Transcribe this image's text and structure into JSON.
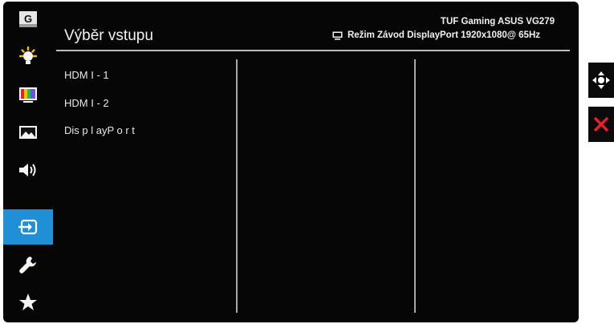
{
  "header": {
    "title": "Výběr vstupu",
    "model": "TUF Gaming ASUS VG279",
    "status": "Režim Závod DisplayPort 1920x1080@ 65Hz"
  },
  "sidebar": {
    "items": [
      {
        "icon": "gamevisual-icon",
        "label": "G"
      },
      {
        "icon": "blue-light-filter-icon"
      },
      {
        "icon": "color-icon"
      },
      {
        "icon": "image-icon"
      },
      {
        "icon": "sound-icon"
      },
      {
        "icon": "input-select-icon",
        "selected": true
      },
      {
        "icon": "system-setup-icon"
      },
      {
        "icon": "my-favorite-icon"
      }
    ]
  },
  "menu": {
    "items": [
      "HDM I - 1",
      "HDM I - 2",
      "Dis p l ayP o r t"
    ]
  },
  "right_buttons": [
    {
      "icon": "navigate-icon"
    },
    {
      "icon": "close-icon"
    }
  ],
  "colors": {
    "background": "#060606",
    "selected": "#1f8fd6",
    "close": "#e8202a",
    "text": "#f2f2f2"
  }
}
